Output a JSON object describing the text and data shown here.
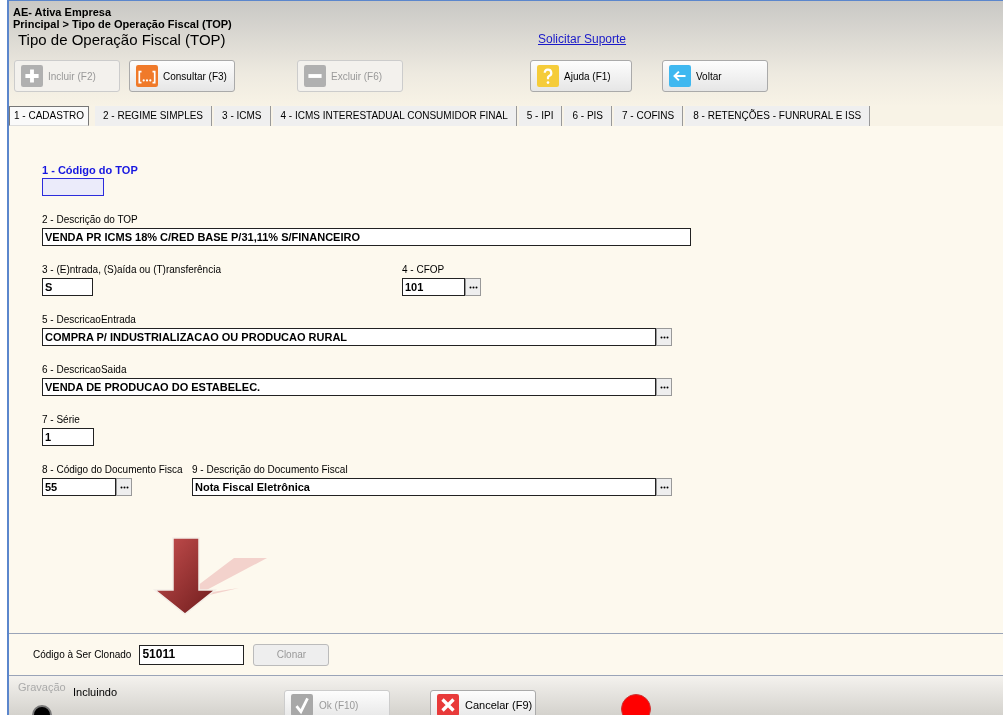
{
  "header": {
    "company": "AE- Ativa Empresa",
    "breadcrumb": "Principal > Tipo de Operação Fiscal (TOP)",
    "title": "Tipo de Operação Fiscal (TOP)",
    "support_link": "Solicitar Suporte"
  },
  "toolbar": [
    {
      "label": "Incluir (F2)",
      "disabled": true
    },
    {
      "label": "Consultar (F3)",
      "disabled": false
    },
    {
      "label": "Excluir (F6)",
      "disabled": true
    },
    {
      "label": "Ajuda (F1)",
      "disabled": false
    },
    {
      "label": "Voltar",
      "disabled": false
    }
  ],
  "tabs": [
    {
      "label": "1 - CADASTRO",
      "selected": true
    },
    {
      "label": "2 -  REGIME SIMPLES",
      "selected": false
    },
    {
      "label": "3 - ICMS",
      "selected": false
    },
    {
      "label": "4 - ICMS INTERESTADUAL CONSUMIDOR FINAL",
      "selected": false
    },
    {
      "label": "5 - IPI",
      "selected": false
    },
    {
      "label": "6 - PIS",
      "selected": false
    },
    {
      "label": "7 - COFINS",
      "selected": false
    },
    {
      "label": "8 - RETENÇÕES - FUNRURAL E ISS",
      "selected": false
    }
  ],
  "form_rows": [
    [
      {
        "label": "1 - Código do TOP",
        "focused": true,
        "lookup": false
      }
    ],
    [
      {
        "label": "2 - Descrição do TOP",
        "value": "VENDA PR ICMS 18% C/RED BASE P/31,11% S/FINANCEIRO",
        "focused": false,
        "lookup": false
      }
    ],
    [
      {
        "label": "3 - (E)ntrada, (S)aída ou (T)ransferência",
        "value": "S",
        "focused": false,
        "lookup": false
      },
      {
        "label": "4 - CFOP",
        "value": "101",
        "focused": false,
        "lookup": true
      }
    ],
    [
      {
        "label": "5 - DescricaoEntrada",
        "value": "COMPRA P/ INDUSTRIALIZACAO OU PRODUCAO RURAL",
        "focused": false,
        "lookup": true
      }
    ],
    [
      {
        "label": "6 - DescricaoSaida",
        "value": "VENDA DE PRODUCAO DO ESTABELEC.",
        "focused": false,
        "lookup": true
      }
    ],
    [
      {
        "label": "7 - Série",
        "value": "1",
        "focused": false,
        "lookup": false
      }
    ],
    [
      {
        "label": "8 - Código do Documento Fisca",
        "value": "55",
        "focused": false,
        "lookup": true
      },
      {
        "label": "9 - Descrição do Documento Fiscal",
        "value": "Nota Fiscal Eletrônica",
        "focused": false,
        "lookup": true
      }
    ]
  ],
  "clone": {
    "label": "Código à Ser Clonado",
    "value": "51011",
    "button": {
      "label": "Clonar",
      "disabled": true
    }
  },
  "footer": {
    "caption": "Gravação",
    "mode": "Incluindo",
    "buttons": [
      {
        "label": "Ok (F10)",
        "disabled": true
      },
      {
        "label": "Cancelar (F9)",
        "disabled": false
      }
    ]
  }
}
